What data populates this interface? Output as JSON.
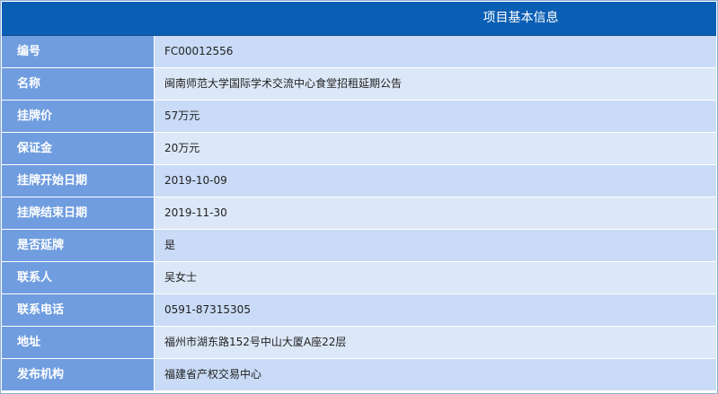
{
  "header": {
    "title": "项目基本信息"
  },
  "rows": [
    {
      "label": "编号",
      "value": "FC00012556"
    },
    {
      "label": "名称",
      "value": "闽南师范大学国际学术交流中心食堂招租延期公告"
    },
    {
      "label": "挂牌价",
      "value": "57万元"
    },
    {
      "label": "保证金",
      "value": "20万元"
    },
    {
      "label": "挂牌开始日期",
      "value": "2019-10-09"
    },
    {
      "label": "挂牌结束日期",
      "value": "2019-11-30"
    },
    {
      "label": "是否延牌",
      "value": "是"
    },
    {
      "label": "联系人",
      "value": "吴女士"
    },
    {
      "label": "联系电话",
      "value": "0591-87315305"
    },
    {
      "label": "地址",
      "value": "福州市湖东路152号中山大厦A座22层"
    },
    {
      "label": "发布机构",
      "value": "福建省产权交易中心"
    }
  ],
  "colors": {
    "header_bg": "#0a5fb4",
    "label_bg": "#6f9ddf",
    "value_bg": "#c9dbf6"
  }
}
